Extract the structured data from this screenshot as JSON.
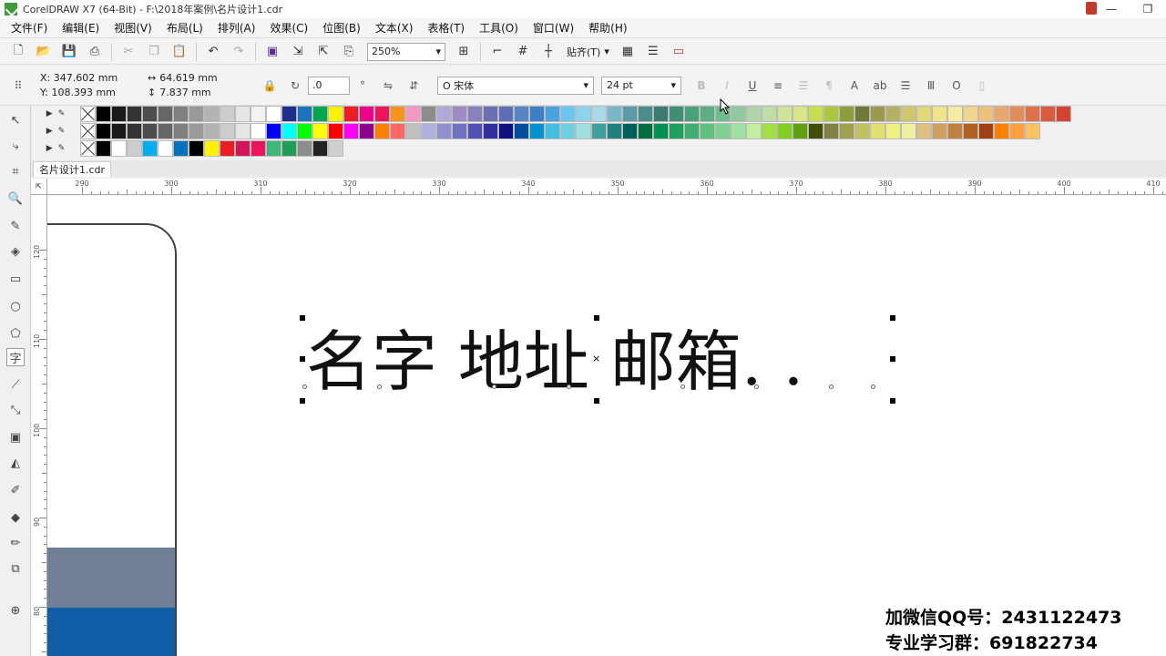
{
  "window": {
    "title": "CorelDRAW X7 (64-Bit) - F:\\2018年案例\\名片设计1.cdr"
  },
  "menu": [
    "文件(F)",
    "编辑(E)",
    "视图(V)",
    "布局(L)",
    "排列(A)",
    "效果(C)",
    "位图(B)",
    "文本(X)",
    "表格(T)",
    "工具(O)",
    "窗口(W)",
    "帮助(H)"
  ],
  "toolbar": {
    "zoom": "250%",
    "snap_label": "贴齐(T)"
  },
  "propbar": {
    "x": "X: 347.602 mm",
    "y": "Y: 108.393 mm",
    "width": "64.619 mm",
    "height": "7.837 mm",
    "angle": ".0",
    "angle_unit": "°",
    "font": "宋体",
    "font_size": "24 pt"
  },
  "palettes": {
    "row1": [
      "#000000",
      "#1a1a1a",
      "#333333",
      "#4d4d4d",
      "#666666",
      "#808080",
      "#999999",
      "#b3b3b3",
      "#cccccc",
      "#e6e6e6",
      "#f2f2f2",
      "#ffffff",
      "#1f2e8c",
      "#1b75bc",
      "#00a650",
      "#fff200",
      "#ed1c24",
      "#ec008c",
      "#ed145b",
      "#f7941d",
      "#f49ac1",
      "#8b8c8e",
      "#b0a8d6",
      "#9e8dc4",
      "#8781bd",
      "#6c6fb3",
      "#5e70b5",
      "#5883c4",
      "#3b82c4",
      "#4aa3df",
      "#6cc5f0",
      "#8dd3f0",
      "#a9d9e8",
      "#7ab8c9",
      "#5b9ba8",
      "#4b8c8c",
      "#3b7b6e",
      "#3d8f75",
      "#4aa17b",
      "#5aaf84",
      "#6fbc8f",
      "#90c9a0",
      "#aed4a8",
      "#c1dca5",
      "#cfe299",
      "#d8e685",
      "#c9de4f",
      "#a9c83d",
      "#8b9e3a",
      "#6e7a36",
      "#9a9a50",
      "#b6b062",
      "#cfc66d",
      "#e3d77a",
      "#f1e38a",
      "#f7eaa1",
      "#f3d58c",
      "#eec07a",
      "#e9a76b",
      "#e38c5b",
      "#de7149",
      "#d95a3d",
      "#d4432f"
    ],
    "row2": [
      "#000000",
      "#1a1a1a",
      "#333333",
      "#4d4d4d",
      "#666666",
      "#808080",
      "#999999",
      "#b3b3b3",
      "#cccccc",
      "#e6e6e6",
      "#ffffff",
      "#0000ff",
      "#00ffff",
      "#00ff00",
      "#ffff00",
      "#ff0000",
      "#ff00ff",
      "#8b008b",
      "#ff7f00",
      "#ff6666",
      "#c0c0c0",
      "#b0b0e0",
      "#9090d0",
      "#7070c0",
      "#5050b0",
      "#3030a0",
      "#101080",
      "#0050a0",
      "#0090d0",
      "#40c0e0",
      "#70d0e0",
      "#a0e0e0",
      "#40a0a0",
      "#208080",
      "#006060",
      "#007040",
      "#009050",
      "#20a060",
      "#40b070",
      "#60c080",
      "#80d090",
      "#a0e0a0",
      "#c0f0a0",
      "#a0e040",
      "#80d020",
      "#60a010",
      "#405000",
      "#808040",
      "#a0a050",
      "#c0c060",
      "#e0e070",
      "#f0f080",
      "#f0f0a0",
      "#e0c080",
      "#d0a060",
      "#c08040",
      "#b06020",
      "#a04010",
      "#ff8000",
      "#ffa040",
      "#ffc060"
    ],
    "row3": [
      "#000000",
      "#ffffff",
      "#cccccc",
      "#00aeef",
      "#ffffff",
      "#0072bc",
      "#000000",
      "#fff200",
      "#ed1c24",
      "#d4145a",
      "#ed145b",
      "#3cb878",
      "#1f9e55",
      "#8c8c8c",
      "#222222",
      "#cfcfcf"
    ]
  },
  "document_tab": "名片设计1.cdr",
  "ruler": {
    "h_labels": [
      "290",
      "300",
      "310",
      "320",
      "330",
      "340",
      "350",
      "360",
      "370",
      "380",
      "390",
      "400",
      "410"
    ],
    "v_labels": [
      "120",
      "110",
      "100",
      "90",
      "80"
    ]
  },
  "canvas": {
    "text_content": "名字  地址  邮箱. ."
  },
  "watermark": {
    "line1": "加微信QQ号：2431122473",
    "line2": "专业学习群：691822734"
  }
}
